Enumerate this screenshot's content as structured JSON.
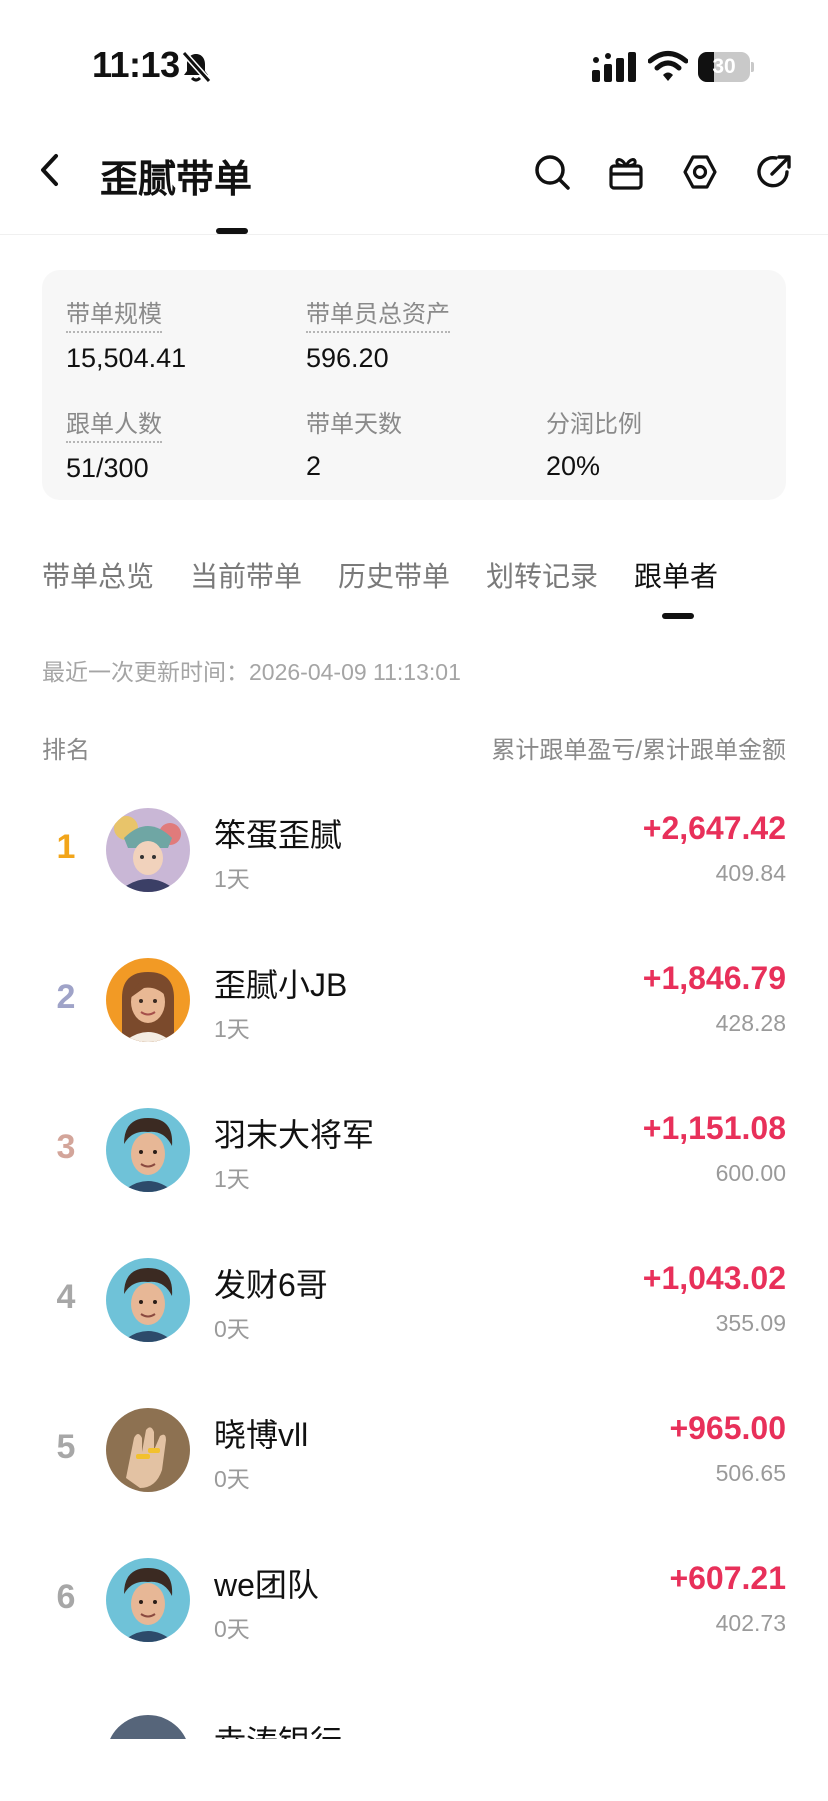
{
  "status_bar": {
    "time": "11:13",
    "battery": "30",
    "battery_level": 0.3
  },
  "header": {
    "title": "歪腻带单"
  },
  "stats": {
    "scale": {
      "label": "带单规模",
      "value": "15,504.41"
    },
    "total_assets": {
      "label": "带单员总资产",
      "value": "596.20"
    },
    "followers": {
      "label": "跟单人数",
      "value": "51/300"
    },
    "days": {
      "label": "带单天数",
      "value": "2"
    },
    "profit_share": {
      "label": "分润比例",
      "value": "20%"
    }
  },
  "tabs": [
    {
      "label": "带单总览"
    },
    {
      "label": "当前带单"
    },
    {
      "label": "历史带单"
    },
    {
      "label": "划转记录"
    },
    {
      "label": "跟单者"
    }
  ],
  "active_tab": "跟单者",
  "update_time": "最近一次更新时间：2026-04-09 11:13:01",
  "list_header": {
    "left": "排名",
    "right": "累计跟单盈亏/累计跟单金额"
  },
  "colors": {
    "profit": "#e8305a",
    "rank_1": "#f2a51a",
    "rank_2": "#9fa3c8",
    "rank_3": "#d3a59a",
    "rank_other": "#a7a7a7"
  },
  "followers": [
    {
      "rank": "1",
      "name": "笨蛋歪腻",
      "days": "1天",
      "pnl": "+2,647.42",
      "amount": "409.84"
    },
    {
      "rank": "2",
      "name": "歪腻小JB",
      "days": "1天",
      "pnl": "+1,846.79",
      "amount": "428.28"
    },
    {
      "rank": "3",
      "name": "羽末大将军",
      "days": "1天",
      "pnl": "+1,151.08",
      "amount": "600.00"
    },
    {
      "rank": "4",
      "name": "发财6哥",
      "days": "0天",
      "pnl": "+1,043.02",
      "amount": "355.09"
    },
    {
      "rank": "5",
      "name": "晓博vll",
      "days": "0天",
      "pnl": "+965.00",
      "amount": "506.65"
    },
    {
      "rank": "6",
      "name": "we团队",
      "days": "0天",
      "pnl": "+607.21",
      "amount": "402.73"
    }
  ],
  "partial_row": {
    "name": "幸涛银行"
  }
}
